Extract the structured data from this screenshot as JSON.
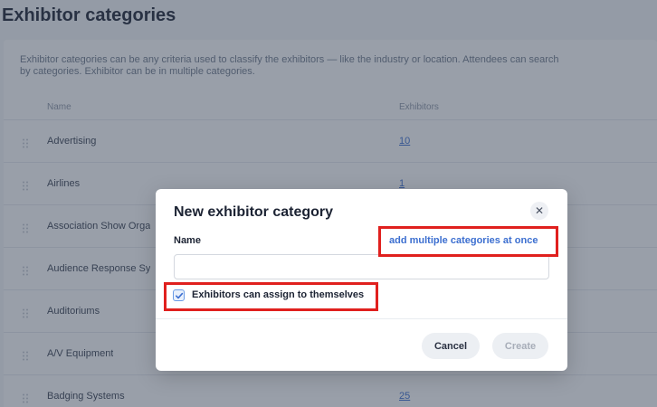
{
  "page": {
    "title": "Exhibitor categories",
    "description": "Exhibitor categories can be any criteria used to classify the exhibitors — like the industry or location. Attendees can search by categories. Exhibitor can be in multiple categories.",
    "columns": {
      "name": "Name",
      "exhibitors": "Exhibitors"
    },
    "rows": [
      {
        "name": "Advertising",
        "count": "10"
      },
      {
        "name": "Airlines",
        "count": "1"
      },
      {
        "name": "Association Show Orga",
        "count": ""
      },
      {
        "name": "Audience Response Sy",
        "count": ""
      },
      {
        "name": "Auditoriums",
        "count": ""
      },
      {
        "name": "A/V Equipment",
        "count": ""
      },
      {
        "name": "Badging Systems",
        "count": "25"
      }
    ]
  },
  "modal": {
    "title": "New exhibitor category",
    "close_icon": "close-icon",
    "name_label": "Name",
    "name_value": "",
    "name_placeholder": "",
    "multiple_link": "add multiple categories at once",
    "checkbox_label": "Exhibitors can assign to themselves",
    "checkbox_checked": true,
    "cancel_label": "Cancel",
    "create_label": "Create"
  },
  "colors": {
    "accent": "#3c6fd0",
    "highlight": "#e0201e",
    "overlay": "#344054"
  }
}
